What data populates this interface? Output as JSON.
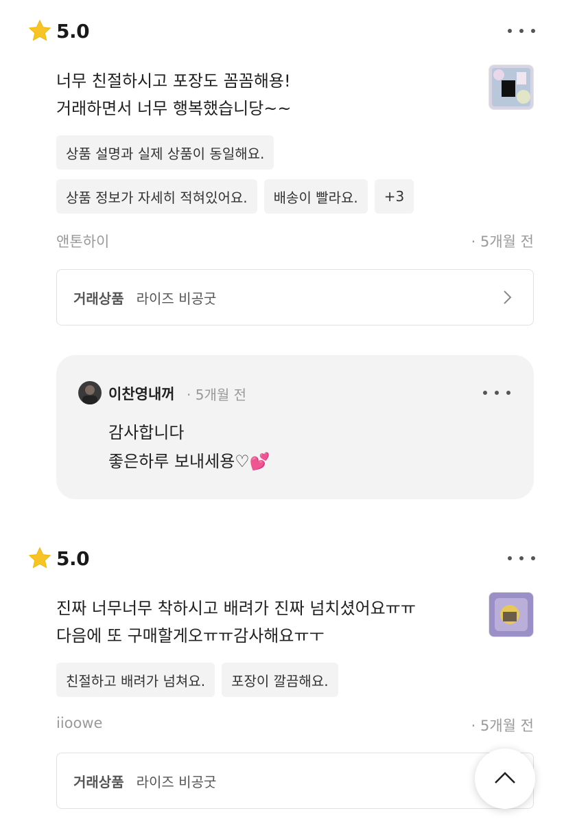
{
  "reviews": [
    {
      "rating": "5.0",
      "text_lines": [
        "너무 친절하시고 포장도 꼼꼼해용!",
        "거래하면서 너무 행복했습니당~~"
      ],
      "tags_row1": [
        "상품 설명과 실제 상품이 동일해요."
      ],
      "tags_row2": [
        "상품 정보가 자세히 적혀있어요.",
        "배송이 빨라요.",
        "+3"
      ],
      "reviewer": "앤톤하이",
      "time": "· 5개월 전",
      "product_label": "거래상품",
      "product_name": "라이즈 비공굿",
      "reply": {
        "name": "이찬영내꺼",
        "time": "· 5개월 전",
        "lines": [
          "감사합니다",
          "좋은하루 보내세용♡"
        ],
        "emoji": "💕"
      }
    },
    {
      "rating": "5.0",
      "text_lines": [
        "진짜 너무너무 착하시고 배려가 진짜 넘치셨어요ㅠㅠ",
        "다음에 또 구매할게오ㅠㅠ감사해요ㅠㅜ"
      ],
      "tags_row1": [
        "친절하고 배려가 넘쳐요.",
        "포장이 깔끔해요."
      ],
      "reviewer": "iioowe",
      "time": "· 5개월 전",
      "product_label": "거래상품",
      "product_name": "라이즈 비공굿"
    }
  ],
  "icons": {
    "star": "star-icon",
    "more": "more-dots-icon",
    "chevron": "chevron-right-icon",
    "scroll_top": "chevron-up-icon"
  },
  "colors": {
    "star": "#f7c325",
    "tag_bg": "#f3f3f3",
    "meta_text": "#999999"
  }
}
